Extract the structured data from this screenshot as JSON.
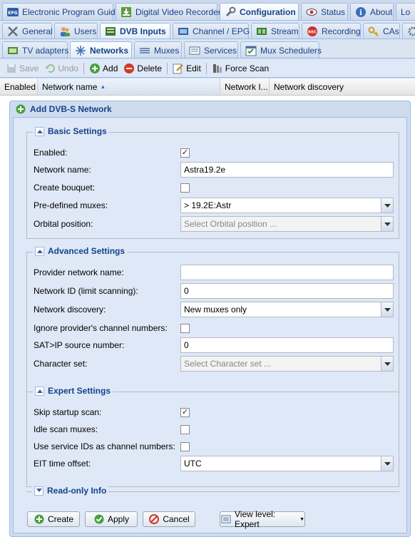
{
  "top_tabs": [
    {
      "label": "Electronic Program Guide",
      "icon": "epg-icon"
    },
    {
      "label": "Digital Video Recorder",
      "icon": "dvr-icon"
    },
    {
      "label": "Configuration",
      "icon": "wrench-icon",
      "active": true
    },
    {
      "label": "Status",
      "icon": "eye-icon"
    },
    {
      "label": "About",
      "icon": "info-icon"
    },
    {
      "label": "Lo",
      "icon": ""
    }
  ],
  "config_tabs": [
    {
      "label": "General",
      "icon": "tools-icon"
    },
    {
      "label": "Users",
      "icon": "users-icon"
    },
    {
      "label": "DVB Inputs",
      "icon": "dvb-icon",
      "active": true
    },
    {
      "label": "Channel / EPG",
      "icon": "tv-icon"
    },
    {
      "label": "Stream",
      "icon": "stream-icon"
    },
    {
      "label": "Recording",
      "icon": "rec-icon"
    },
    {
      "label": "CAs",
      "icon": "key-icon"
    }
  ],
  "dvb_tabs": [
    {
      "label": "TV adapters",
      "icon": "adapter-icon"
    },
    {
      "label": "Networks",
      "icon": "network-icon",
      "active": true
    },
    {
      "label": "Muxes",
      "icon": "muxes-icon"
    },
    {
      "label": "Services",
      "icon": "services-icon"
    },
    {
      "label": "Mux Schedulers",
      "icon": "scheduler-icon"
    }
  ],
  "toolbar": {
    "save": "Save",
    "undo": "Undo",
    "add": "Add",
    "delete": "Delete",
    "edit": "Edit",
    "force_scan": "Force Scan"
  },
  "grid": {
    "columns": [
      "Enabled",
      "Network name",
      "Network I...",
      "Network discovery"
    ]
  },
  "dialog": {
    "title": "Add DVB-S Network",
    "basic": {
      "legend": "Basic Settings",
      "enabled_label": "Enabled:",
      "enabled": true,
      "network_name_label": "Network name:",
      "network_name": "Astra19.2e",
      "create_bouquet_label": "Create bouquet:",
      "create_bouquet": false,
      "predefined_muxes_label": "Pre-defined muxes:",
      "predefined_muxes": "> 19.2E:Astr",
      "orbital_label": "Orbital position:",
      "orbital_placeholder": "Select Orbital position ..."
    },
    "advanced": {
      "legend": "Advanced Settings",
      "provider_label": "Provider network name:",
      "provider": "",
      "network_id_label": "Network ID (limit scanning):",
      "network_id": "0",
      "discovery_label": "Network discovery:",
      "discovery": "New muxes only",
      "ignore_label": "Ignore provider's channel numbers:",
      "ignore": false,
      "satip_label": "SAT>IP source number:",
      "satip": "0",
      "charset_label": "Character set:",
      "charset_placeholder": "Select Character set ..."
    },
    "expert": {
      "legend": "Expert Settings",
      "skip_label": "Skip startup scan:",
      "skip": true,
      "idle_label": "Idle scan muxes:",
      "idle": false,
      "sid_label": "Use service IDs as channel numbers:",
      "sid": false,
      "eit_label": "EIT time offset:",
      "eit": "UTC"
    },
    "readonly": {
      "legend": "Read-only Info"
    },
    "buttons": {
      "create": "Create",
      "apply": "Apply",
      "cancel": "Cancel",
      "view_level": "View level: Expert"
    }
  }
}
